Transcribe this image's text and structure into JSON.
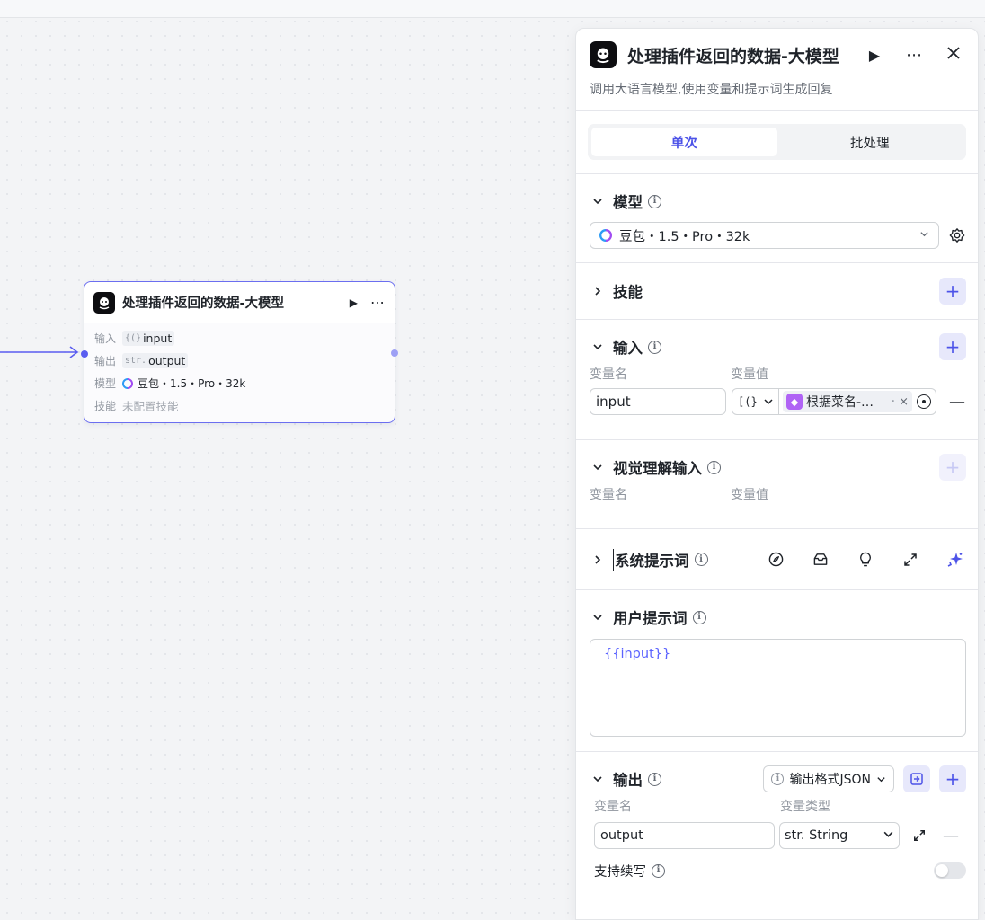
{
  "node": {
    "title": "处理插件返回的数据-大模型",
    "input_label": "输入",
    "input_type": "{(}",
    "input_value": "input",
    "output_label": "输出",
    "output_type": "str.",
    "output_value": "output",
    "model_label": "模型",
    "model_value": "豆包・1.5・Pro・32k",
    "skill_label": "技能",
    "skill_value": "未配置技能"
  },
  "panel": {
    "title": "处理插件返回的数据-大模型",
    "description": "调用大语言模型,使用变量和提示词生成回复",
    "tabs": [
      {
        "label": "单次",
        "active": true
      },
      {
        "label": "批处理",
        "active": false
      }
    ],
    "model": {
      "title": "模型",
      "selected": "豆包・1.5・Pro・32k"
    },
    "skills": {
      "title": "技能"
    },
    "inputs": {
      "title": "输入",
      "col_name": "变量名",
      "col_value": "变量值",
      "rows": [
        {
          "name": "input",
          "type": "[(}",
          "ref": "根据菜名-…",
          "ref_suffix": "·"
        }
      ]
    },
    "vision": {
      "title": "视觉理解输入",
      "col_name": "变量名",
      "col_value": "变量值"
    },
    "system_prompt": {
      "title": "系统提示词"
    },
    "user_prompt": {
      "title": "用户提示词",
      "content": "{{input}}"
    },
    "outputs": {
      "title": "输出",
      "format_label": "输出格式JSON",
      "col_name": "变量名",
      "col_type": "变量类型",
      "rows": [
        {
          "name": "output",
          "type": "str. String"
        }
      ],
      "continue_label": "支持续写",
      "continue_enabled": false
    }
  },
  "colors": {
    "accent": "#4d53e8",
    "node_border": "#6b6ef0",
    "ref_icon": "#b063f5"
  },
  "icons": {
    "node_logo": "bot-logo-icon",
    "run": "play-icon",
    "more": "more-icon",
    "close": "close-icon",
    "settings": "gear-icon",
    "compass": "compass-icon",
    "library": "prompt-library-icon",
    "bulb": "bulb-icon",
    "expand": "expand-icon",
    "sparkle": "ai-optimize-icon"
  }
}
